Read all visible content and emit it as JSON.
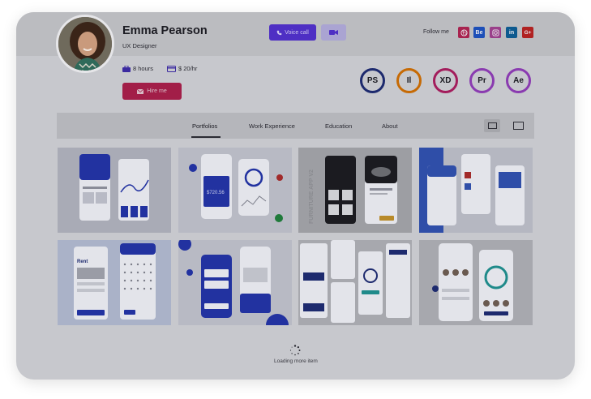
{
  "profile": {
    "name": "Emma Pearson",
    "role": "UX Designer",
    "hours": "8 hours",
    "rate": "$ 20/hr",
    "hire_label": "Hire me"
  },
  "actions": {
    "voice_call_label": "Voice call"
  },
  "social": {
    "follow_label": "Follow me",
    "links": [
      {
        "label": "",
        "icon": "dribbble-icon",
        "color": "#a8234f"
      },
      {
        "label": "Be",
        "icon": "behance-icon",
        "color": "#1d4fb8"
      },
      {
        "label": "",
        "icon": "instagram-icon",
        "color": "#9a3f8a"
      },
      {
        "label": "in",
        "icon": "linkedin-icon",
        "color": "#0e5a8f"
      },
      {
        "label": "G+",
        "icon": "google-plus-icon",
        "color": "#b02222"
      }
    ]
  },
  "skills": [
    {
      "label": "PS",
      "color": "#1d2a6e"
    },
    {
      "label": "Il",
      "color": "#c66a05"
    },
    {
      "label": "XD",
      "color": "#a31d5c"
    },
    {
      "label": "Pr",
      "color": "#8a3bb0"
    },
    {
      "label": "Ae",
      "color": "#8a3bb0"
    }
  ],
  "tabs": {
    "portfolios": "Portfolios",
    "work_experience": "Work Experience",
    "education": "Education",
    "about": "About"
  },
  "portfolio_tiles": [
    {
      "icon": "wallet-app-mockup",
      "bg": "#a9abb6"
    },
    {
      "icon": "finance-app-mockup",
      "bg": "#b8bac4"
    },
    {
      "icon": "furniture-app-mockup",
      "bg": "#9d9ea3"
    },
    {
      "icon": "health-app-mockup",
      "bg": "#2f4ea8"
    },
    {
      "icon": "apartment-booking-mockup",
      "bg": "#aab2c8"
    },
    {
      "icon": "smart-home-mockup",
      "bg": "#b8bac4"
    },
    {
      "icon": "banking-dashboard-mockup",
      "bg": "#a7a8ae"
    },
    {
      "icon": "fitness-app-mockup",
      "bg": "#a7a8ae"
    }
  ],
  "furniture_caption": "FURNITURE APP V2",
  "loading_text": "Loading more item",
  "colors": {
    "accent_purple": "#4e2fc4",
    "hire_red": "#a21e48",
    "overlay_bg": "#c7c8cd"
  }
}
